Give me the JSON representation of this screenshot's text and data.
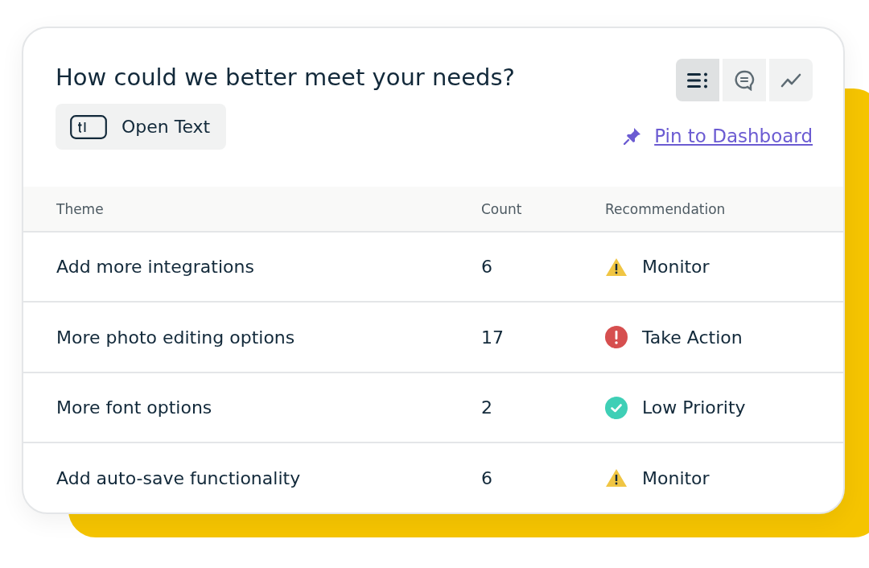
{
  "card": {
    "title": "How could we better meet your needs?",
    "question_type": "Open Text",
    "views": [
      {
        "kind": "list",
        "selected": true
      },
      {
        "kind": "comments",
        "selected": false
      },
      {
        "kind": "trend",
        "selected": false
      }
    ],
    "pin_link": "Pin to Dashboard"
  },
  "table": {
    "columns": [
      "Theme",
      "Count",
      "Recommendation"
    ],
    "rows": [
      {
        "theme": "Add more integrations",
        "count": "6",
        "kind": "warning",
        "recommendation": "Monitor"
      },
      {
        "theme": "More photo editing options",
        "count": "17",
        "kind": "error",
        "recommendation": "Take Action"
      },
      {
        "theme": "More font options",
        "count": "2",
        "kind": "success",
        "recommendation": "Low Priority"
      },
      {
        "theme": "Add auto-save functionality",
        "count": "6",
        "kind": "warning",
        "recommendation": "Monitor"
      }
    ]
  }
}
